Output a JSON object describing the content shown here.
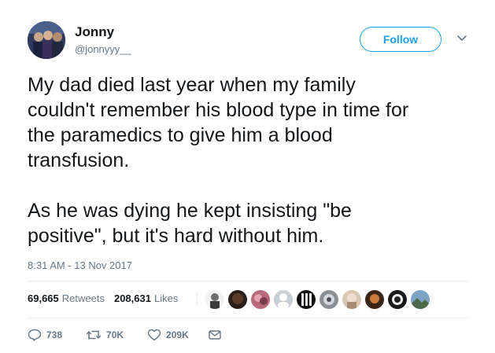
{
  "user": {
    "name": "Jonny",
    "handle": "@jonnyyy__"
  },
  "follow_label": "Follow",
  "tweet": {
    "text": "My dad died last year when my family\ncouldn't remember his blood type in time for\nthe paramedics to give him a blood\ntransfusion.\n\nAs he was dying he kept insisting \"be\npositive\", but it's hard without him.",
    "timestamp": "8:31 AM - 13 Nov 2017"
  },
  "stats": {
    "retweets_count": "69,665",
    "retweets_label": "Retweets",
    "likes_count": "208,631",
    "likes_label": "Likes"
  },
  "actions": {
    "reply_count": "738",
    "retweet_count": "70K",
    "like_count": "209K"
  },
  "colors": {
    "accent": "#1da1f2",
    "secondary_text": "#657786",
    "divider": "#e6ecf0"
  },
  "icons": [
    "chevron-down-icon",
    "reply-icon",
    "retweet-icon",
    "heart-icon",
    "message-icon"
  ]
}
